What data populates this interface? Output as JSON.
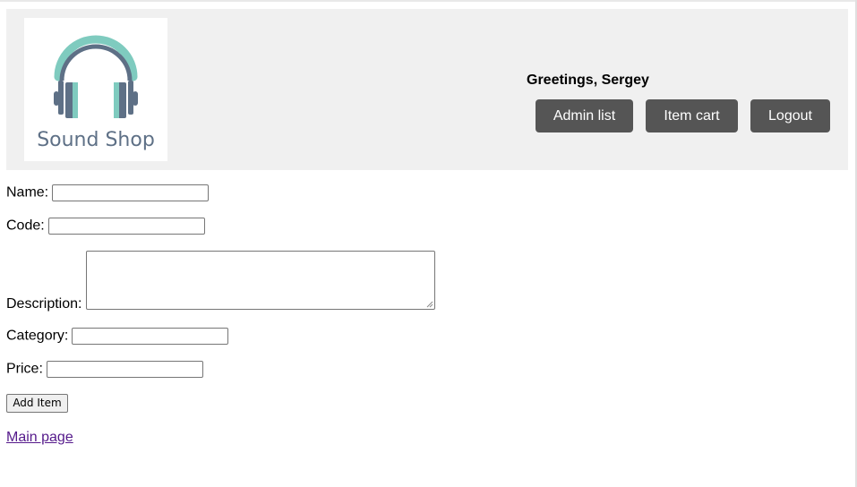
{
  "header": {
    "logo_text": "Sound Shop",
    "greeting": "Greetings, Sergey",
    "buttons": {
      "admin_list": "Admin list",
      "item_cart": "Item cart",
      "logout": "Logout"
    }
  },
  "form": {
    "name_label": "Name:",
    "name_value": "",
    "code_label": "Code:",
    "code_value": "",
    "description_label": "Description:",
    "description_value": "",
    "category_label": "Category:",
    "category_value": "",
    "price_label": "Price:",
    "price_value": "",
    "submit_label": "Add Item"
  },
  "footer": {
    "main_page_link": "Main page"
  },
  "colors": {
    "header_bg": "#f0f0f0",
    "nav_button_bg": "#555555",
    "logo_accent": "#7fcbbf",
    "logo_dark": "#5e7086",
    "visited_link": "#551a8b"
  }
}
